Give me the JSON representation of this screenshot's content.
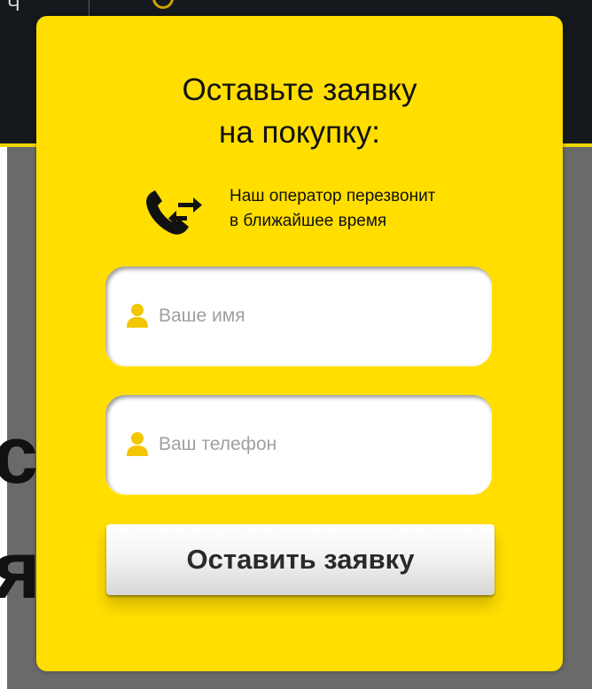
{
  "background": {
    "topbar_fragment": "Ч",
    "text_fragment_1": "с",
    "text_fragment_2": "я"
  },
  "modal": {
    "title": "Оставьте заявку\nна покупку:",
    "callback_text": "Наш оператор перезвонит\nв ближайшее время",
    "name_field": {
      "value": "",
      "placeholder": "Ваше имя"
    },
    "phone_field": {
      "value": "",
      "placeholder": "Ваш телефон"
    },
    "submit_label": "Оставить заявку"
  },
  "icons": {
    "phone": "phone-callback-icon",
    "user": "user-icon"
  },
  "colors": {
    "modal_background": "#ffde00",
    "header_background": "#15181c",
    "overlay": "#6a6a6a",
    "icon": "#111111",
    "field_icon": "#f2c600"
  }
}
